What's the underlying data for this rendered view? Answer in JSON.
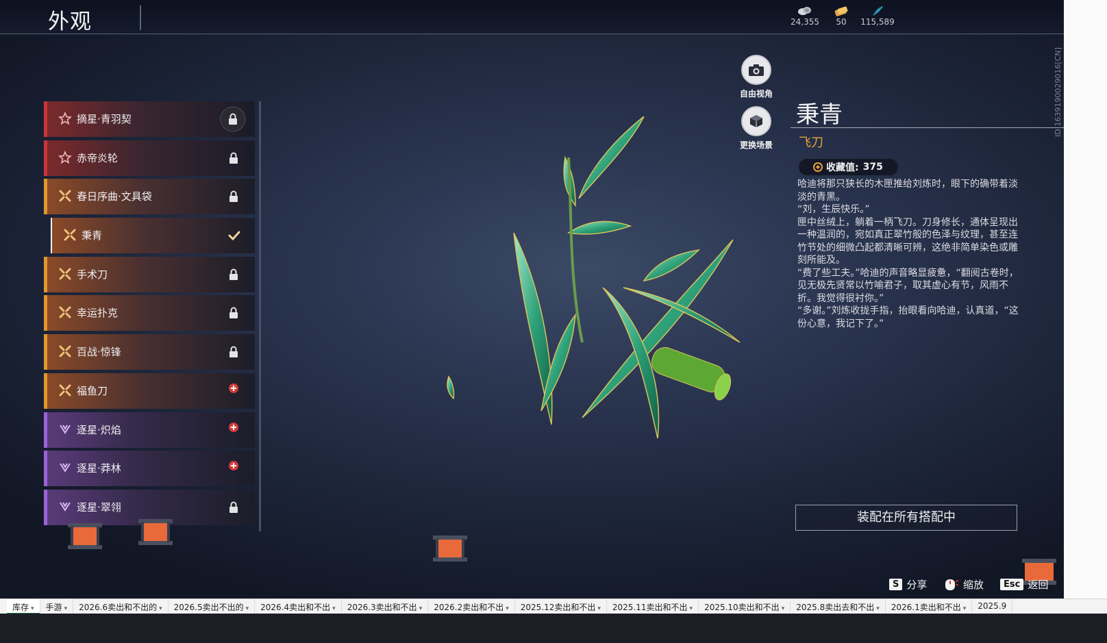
{
  "header": {
    "title": "外观"
  },
  "currencies": [
    {
      "icon": "coin-pile-icon",
      "value": "24,355"
    },
    {
      "icon": "ticket-icon",
      "value": "50"
    },
    {
      "icon": "feather-icon",
      "value": "115,589"
    }
  ],
  "items": [
    {
      "label": "摘星·青羽契",
      "rarity": "red",
      "status": "lock-badge"
    },
    {
      "label": "赤帝炎轮",
      "rarity": "red",
      "status": "lock"
    },
    {
      "label": "春日序曲·文具袋",
      "rarity": "orange",
      "status": "lock"
    },
    {
      "label": "秉青",
      "rarity": "orange",
      "status": "check"
    },
    {
      "label": "手术刀",
      "rarity": "orange",
      "status": "lock"
    },
    {
      "label": "幸运扑克",
      "rarity": "orange",
      "status": "lock"
    },
    {
      "label": "百战·惊锋",
      "rarity": "orange",
      "status": "lock"
    },
    {
      "label": "福鱼刀",
      "rarity": "orange",
      "status": "new"
    },
    {
      "label": "逐星·炽焰",
      "rarity": "purple",
      "status": "new"
    },
    {
      "label": "逐星·莽林",
      "rarity": "purple",
      "status": "new"
    },
    {
      "label": "逐星·翠翎",
      "rarity": "purple",
      "status": "lock"
    }
  ],
  "camera": {
    "free_view": "自由视角",
    "change_scene": "更换场景"
  },
  "detail": {
    "name": "秉青",
    "type": "飞刀",
    "collection_label": "收藏值:",
    "collection_value": "375",
    "description": "哈迪将那只狭长的木匣推给刘炼时，眼下的确带着淡淡的青黑。\n“刘，生辰快乐。”\n匣中丝绒上，躺着一柄飞刀。刀身修长，通体呈现出一种温润的，宛如真正翠竹般的色泽与纹理，甚至连竹节处的细微凸起都清晰可辨，这绝非简单染色或雕刻所能及。\n“费了些工夫。”哈迪的声音略显疲惫，“翻阅古卷时，见无极先贤常以竹喻君子，取其虚心有节，风雨不折。我觉得很衬你。”\n“多谢。”刘炼收拢手指，抬眼看向哈迪，认真道，“这份心意，我记下了。”",
    "equip_button": "装配在所有搭配中"
  },
  "hints": [
    {
      "key": "S",
      "label": "分享"
    },
    {
      "key": "mouse",
      "label": "缩放"
    },
    {
      "key": "Esc",
      "label": "返回"
    }
  ],
  "side_id": "ID:1639190029016[CN]",
  "sheet_tabs": [
    "库存",
    "手游",
    "2026.6卖出和不出的",
    "2026.5卖出不出的",
    "2026.4卖出和不出",
    "2026.3卖出和不出",
    "2026.2卖出和不出",
    "2025.12卖出和不出",
    "2025.11卖出和不出",
    "2025.10卖出和不出",
    "2025.8卖出去和不出",
    "2026.1卖出和不出",
    "2025.9"
  ],
  "colors": {
    "red": "#c8353a",
    "orange": "#e2962e",
    "purple": "#9b62d8",
    "accent": "#e9a23b"
  }
}
